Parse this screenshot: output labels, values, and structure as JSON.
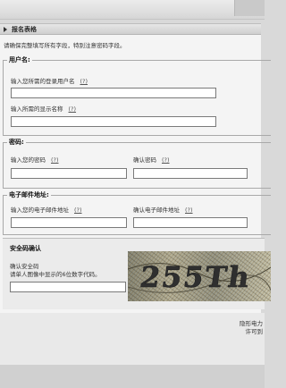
{
  "section": {
    "title": "报名表格",
    "instructions": "请确保完整填写所有字段，特别注意密码字段。"
  },
  "help_glyph": "(?)",
  "username_group": {
    "legend": "用户名:",
    "login_label": "输入您所需的登录用户名",
    "login_value": "",
    "display_label": "输入所需的显示名称",
    "display_value": ""
  },
  "password_group": {
    "legend": "密码:",
    "password_label": "输入您的密码",
    "confirm_label": "确认密码",
    "password_value": "",
    "confirm_value": ""
  },
  "email_group": {
    "legend": "电子邮件地址:",
    "email_label": "输入您的电子邮件地址",
    "confirm_label": "确认电子邮件地址",
    "email_value": "",
    "confirm_value": ""
  },
  "captcha": {
    "title": "安全码确认",
    "line1": "确认安全码",
    "line2": "请单人图像中显示的6位数字代码。",
    "code_value": "",
    "image_text": "255Th"
  },
  "footer": {
    "line1": "隐形电力",
    "line2": "许可到"
  }
}
